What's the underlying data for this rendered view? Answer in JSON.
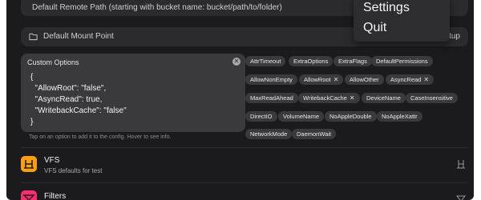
{
  "remote_path": {
    "placeholder": "Default Remote Path (starting with bucket name: bucket/path/to/folder)"
  },
  "mount_point": {
    "label": "Default Mount Point",
    "setup_label": "tup"
  },
  "custom_options": {
    "title": "Custom Options",
    "lines": [
      "{",
      "  \"AllowRoot\": \"false\",",
      "  \"AsyncRead\": true,",
      "  \"WritebackCache\": \"false\"",
      "}"
    ]
  },
  "chips": [
    {
      "label": "AttrTimeout"
    },
    {
      "label": "ExtraOptions"
    },
    {
      "label": "ExtraFlags"
    },
    {
      "label": "DefaultPermissions"
    },
    {
      "label": "AllowNonEmpty"
    },
    {
      "label": "AllowRoot",
      "removable": true
    },
    {
      "label": "AllowOther"
    },
    {
      "label": "AsyncRead",
      "removable": true
    },
    {
      "label": "MaxReadAhead"
    },
    {
      "label": "WritebackCache",
      "removable": true
    },
    {
      "label": "DeviceName"
    },
    {
      "label": "CaseInsensitive"
    },
    {
      "label": "DirectIO"
    },
    {
      "label": "VolumeName"
    },
    {
      "label": "NoAppleDouble"
    },
    {
      "label": "NoAppleXattr"
    },
    {
      "label": "NetworkMode"
    },
    {
      "label": "DaemonWait"
    }
  ],
  "hint": "Tap on an option to add it to the config. Hover to see info.",
  "sections": [
    {
      "title": "VFS",
      "subtitle": "VFS defaults for test",
      "color": "#ff9f0a",
      "icon": "vfs-icon"
    },
    {
      "title": "Filters",
      "color": "#ff2d6f",
      "icon": "filter-icon"
    }
  ],
  "menu": {
    "items": [
      "Settings",
      "Quit"
    ]
  },
  "icons": {
    "remove": "✕",
    "clear": "✕"
  }
}
